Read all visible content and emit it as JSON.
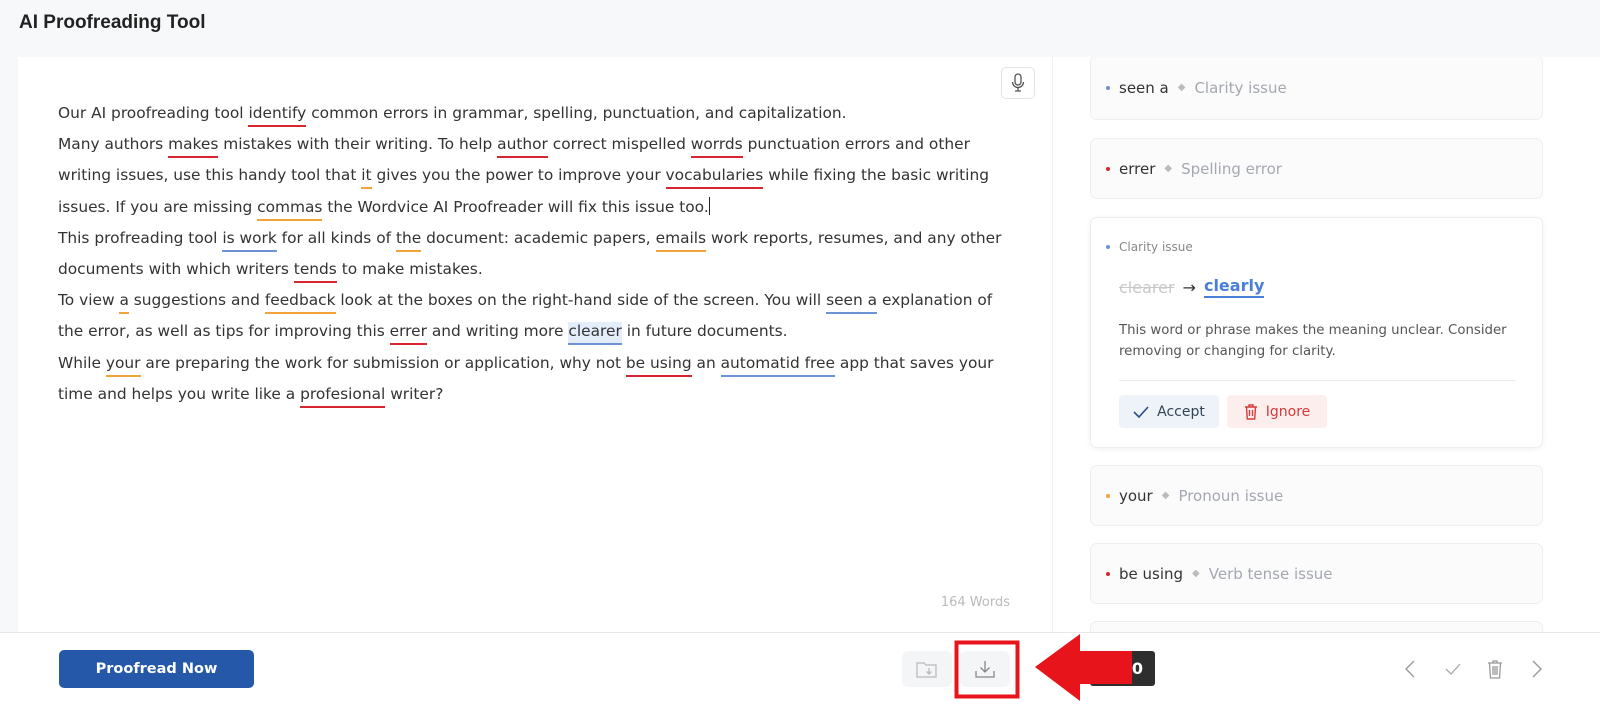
{
  "header": {
    "title": "AI Proofreading Tool"
  },
  "colors": {
    "red": "#d7262f",
    "orange": "#f2a33a",
    "blue": "#6b93d6",
    "primary": "#2558a8"
  },
  "editor": {
    "paragraphs": [
      [
        {
          "t": "Our AI proofreading tool "
        },
        {
          "t": "identify",
          "u": "red"
        },
        {
          "t": " common errors in grammar, spelling, punctuation, and capitalization."
        }
      ],
      [
        {
          "t": "Many authors "
        },
        {
          "t": "makes",
          "u": "red"
        },
        {
          "t": " mistakes with their writing. To help "
        },
        {
          "t": "author",
          "u": "red"
        },
        {
          "t": " correct mispelled "
        },
        {
          "t": "worrds",
          "u": "red"
        },
        {
          "t": " punctuation errors and other writing issues, use this handy tool that "
        },
        {
          "t": "it",
          "u": "orange"
        },
        {
          "t": " gives you the power to improve your "
        },
        {
          "t": "vocabularies",
          "u": "red"
        },
        {
          "t": " while fixing the basic writing issues. If you are missing "
        },
        {
          "t": "commas",
          "u": "orange"
        },
        {
          "t": " the Wordvice AI Proofreader will fix this issue too."
        },
        {
          "cursor": true
        }
      ],
      [
        {
          "t": "This profreading tool "
        },
        {
          "t": "is work",
          "u": "blue"
        },
        {
          "t": " for all kinds of "
        },
        {
          "t": "the",
          "u": "orange"
        },
        {
          "t": " document: academic papers, "
        },
        {
          "t": "emails",
          "u": "orange"
        },
        {
          "t": " work reports, resumes, and any other documents with which writers "
        },
        {
          "t": "tends",
          "u": "red"
        },
        {
          "t": " to make mistakes."
        }
      ],
      [
        {
          "t": "To view "
        },
        {
          "t": "a",
          "u": "orange"
        },
        {
          "t": " suggestions and "
        },
        {
          "t": "feedback",
          "u": "orange"
        },
        {
          "t": " look at the boxes on the right-hand side of the screen. You will "
        },
        {
          "t": "seen a",
          "u": "blue"
        },
        {
          "t": " explanation of the error, as well as tips for improving this "
        },
        {
          "t": "errer",
          "u": "red"
        },
        {
          "t": " and writing more "
        },
        {
          "t": "clearer",
          "u": "blue",
          "hl": true
        },
        {
          "t": " in future documents."
        }
      ],
      [
        {
          "t": "While "
        },
        {
          "t": "your",
          "u": "orange"
        },
        {
          "t": " are preparing the work for submission or application, why not "
        },
        {
          "t": "be using",
          "u": "red"
        },
        {
          "t": " an "
        },
        {
          "t": "automatid free",
          "u": "blue"
        },
        {
          "t": " app that saves your time and helps you write like a "
        },
        {
          "t": "profesional",
          "u": "red"
        },
        {
          "t": " writer?"
        }
      ]
    ],
    "word_count": "164 Words",
    "mic_icon": "microphone-icon"
  },
  "issues": {
    "cards": [
      {
        "word": "seen a",
        "category": "Clarity issue",
        "color": "blue"
      },
      {
        "word": "errer",
        "category": "Spelling error",
        "color": "red"
      },
      {
        "word": "your",
        "category": "Pronoun issue",
        "color": "orange"
      },
      {
        "word": "be using",
        "category": "Verb tense issue",
        "color": "red"
      }
    ],
    "expanded": {
      "category": "Clarity issue",
      "original": "clearer",
      "arrow": "→",
      "suggestion": "clearly",
      "description": "This word or phrase makes the meaning unclear. Consider removing or changing for clarity.",
      "accept_label": "Accept",
      "ignore_label": "Ignore"
    }
  },
  "footer": {
    "proofread_label": "Proofread Now",
    "issue_count": "20"
  }
}
